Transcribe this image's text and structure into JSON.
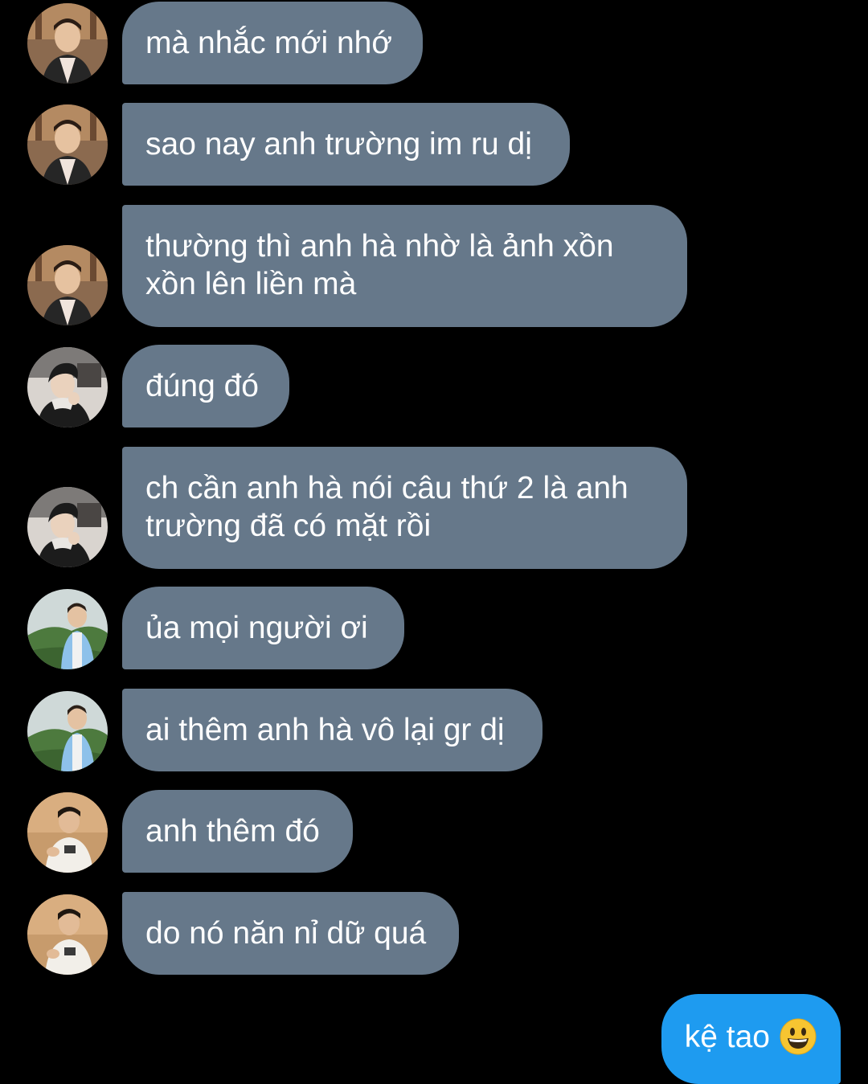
{
  "messages": [
    {
      "text": "mà nhắc mới nhớ",
      "avatar": "avatar-user-a"
    },
    {
      "text": "sao nay anh trường im ru dị",
      "avatar": "avatar-user-a"
    },
    {
      "text": "thường thì anh hà nhờ là ảnh xồn\nxồn lên liền mà",
      "avatar": "avatar-user-a"
    },
    {
      "text": "đúng đó",
      "avatar": "avatar-user-b"
    },
    {
      "text": "ch cần anh hà nói câu thứ 2 là anh\ntrường đã có mặt rồi",
      "avatar": "avatar-user-b"
    },
    {
      "text": "ủa mọi người ơi",
      "avatar": "avatar-user-c"
    },
    {
      "text": "ai thêm anh hà vô lại gr dị",
      "avatar": "avatar-user-c"
    },
    {
      "text": "anh thêm đó",
      "avatar": "avatar-user-d"
    },
    {
      "text": "do nó năn nỉ dữ quá",
      "avatar": "avatar-user-d"
    }
  ],
  "outgoing": {
    "text": "kệ tao",
    "emoji": "grinning-face-icon"
  },
  "colors": {
    "background": "#000000",
    "incoming_bubble": "#66788a",
    "outgoing_bubble": "#1e9bf0",
    "text": "#ffffff"
  }
}
